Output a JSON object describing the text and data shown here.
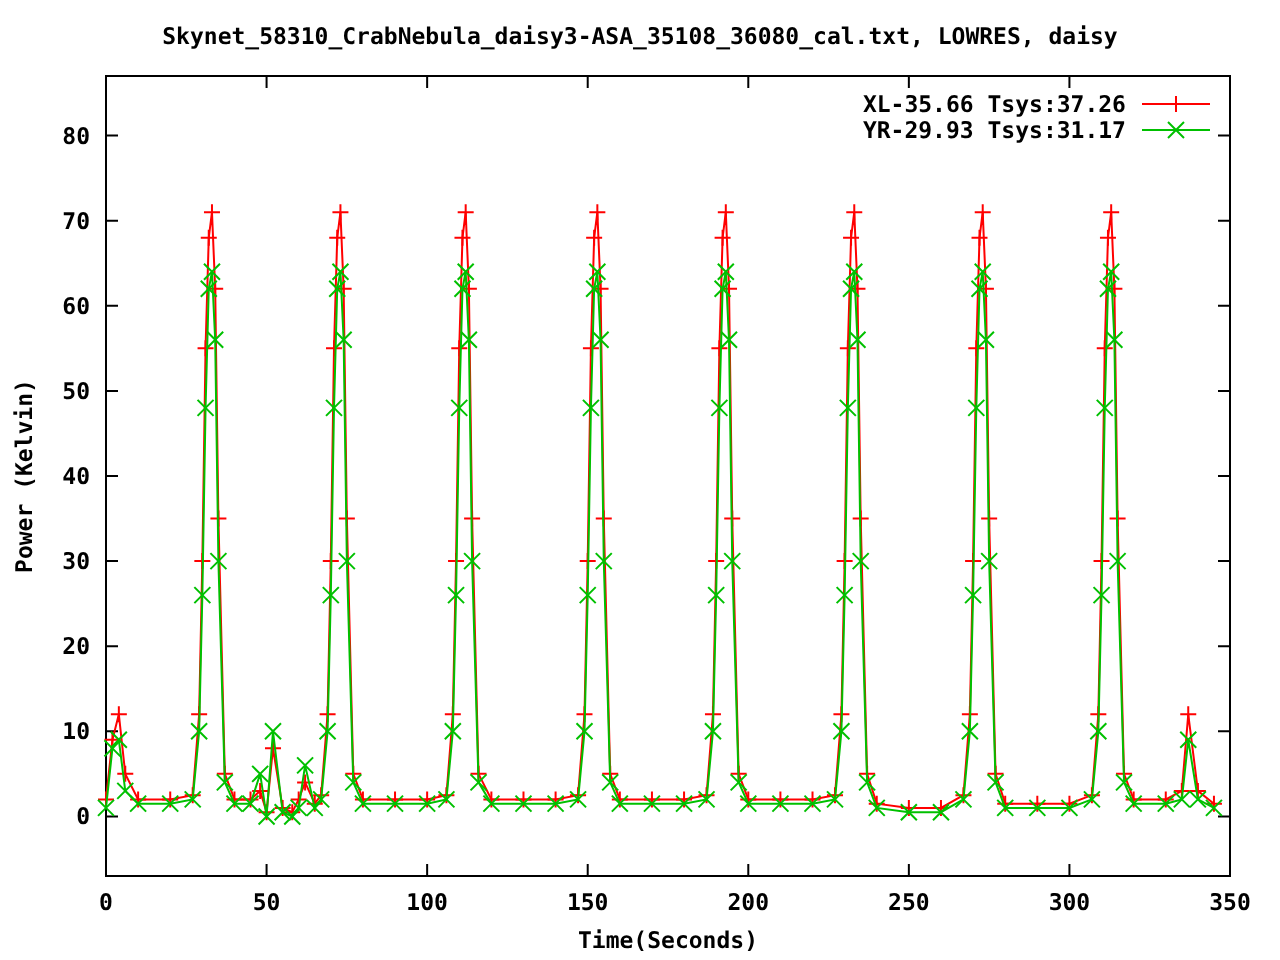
{
  "chart": {
    "chart_data": {
      "type": "line",
      "title": "Skynet_58310_CrabNebula_daisy3-ASA_35108_36080_cal.txt, LOWRES, daisy",
      "xlabel": "Time(Seconds)",
      "ylabel": "Power (Kelvin)",
      "xlim": [
        0,
        350
      ],
      "ylim": [
        -7,
        87
      ],
      "xticks": [
        0,
        50,
        100,
        150,
        200,
        250,
        300,
        350
      ],
      "yticks": [
        0,
        10,
        20,
        30,
        40,
        50,
        60,
        70,
        80
      ],
      "legend": true,
      "x": [
        0,
        2,
        4,
        6,
        10,
        20,
        27,
        29,
        30,
        31,
        32,
        33,
        34,
        35,
        37,
        40,
        45,
        48,
        50,
        52,
        55,
        58,
        60,
        62,
        65,
        67,
        69,
        70,
        71,
        72,
        73,
        74,
        75,
        77,
        80,
        90,
        100,
        106,
        108,
        109,
        110,
        111,
        112,
        113,
        114,
        116,
        120,
        130,
        140,
        147,
        149,
        150,
        151,
        152,
        153,
        154,
        155,
        157,
        160,
        170,
        180,
        187,
        189,
        190,
        191,
        192,
        193,
        194,
        195,
        197,
        200,
        210,
        220,
        227,
        229,
        230,
        231,
        232,
        233,
        234,
        235,
        237,
        240,
        250,
        260,
        267,
        269,
        270,
        271,
        272,
        273,
        274,
        275,
        277,
        280,
        290,
        300,
        307,
        309,
        310,
        311,
        312,
        313,
        314,
        315,
        317,
        320,
        330,
        335,
        337,
        340,
        345
      ],
      "series": [
        {
          "name": "XL-35.66 Tsys:37.26",
          "color": "#ff0000",
          "marker": "plus",
          "values": [
            2,
            9,
            12,
            5,
            2,
            2,
            2.5,
            12,
            30,
            55,
            68,
            71,
            62,
            35,
            5,
            2,
            2,
            3,
            0.5,
            8,
            1,
            0.5,
            2,
            4,
            1.5,
            2.5,
            12,
            30,
            55,
            68,
            71,
            62,
            35,
            5,
            2,
            2,
            2,
            2.5,
            12,
            30,
            55,
            68,
            71,
            62,
            35,
            5,
            2,
            2,
            2,
            2.5,
            12,
            30,
            55,
            68,
            71,
            62,
            35,
            5,
            2,
            2,
            2,
            2.5,
            12,
            30,
            55,
            68,
            71,
            62,
            35,
            5,
            2,
            2,
            2,
            2.5,
            12,
            30,
            55,
            68,
            71,
            62,
            35,
            5,
            1.5,
            1,
            1,
            2.5,
            12,
            30,
            55,
            68,
            71,
            62,
            35,
            5,
            1.5,
            1.5,
            1.5,
            2.5,
            12,
            30,
            55,
            68,
            71,
            62,
            35,
            5,
            2,
            2,
            3,
            12,
            3,
            1.5
          ]
        },
        {
          "name": "YR-29.93 Tsys:31.17",
          "color": "#00c000",
          "marker": "cross",
          "values": [
            1,
            8,
            9,
            3,
            1.5,
            1.5,
            2,
            10,
            26,
            48,
            62,
            64,
            56,
            30,
            4,
            1.5,
            1.5,
            5,
            0,
            10,
            0.5,
            0,
            1,
            6,
            1,
            2,
            10,
            26,
            48,
            62,
            64,
            56,
            30,
            4,
            1.5,
            1.5,
            1.5,
            2,
            10,
            26,
            48,
            62,
            64,
            56,
            30,
            4,
            1.5,
            1.5,
            1.5,
            2,
            10,
            26,
            48,
            62,
            64,
            56,
            30,
            4,
            1.5,
            1.5,
            1.5,
            2,
            10,
            26,
            48,
            62,
            64,
            56,
            30,
            4,
            1.5,
            1.5,
            1.5,
            2,
            10,
            26,
            48,
            62,
            64,
            56,
            30,
            4,
            1,
            0.5,
            0.5,
            2,
            10,
            26,
            48,
            62,
            64,
            56,
            30,
            4,
            1,
            1,
            1,
            2,
            10,
            26,
            48,
            62,
            64,
            56,
            30,
            4,
            1.5,
            1.5,
            2,
            9,
            2,
            1
          ]
        }
      ]
    }
  }
}
